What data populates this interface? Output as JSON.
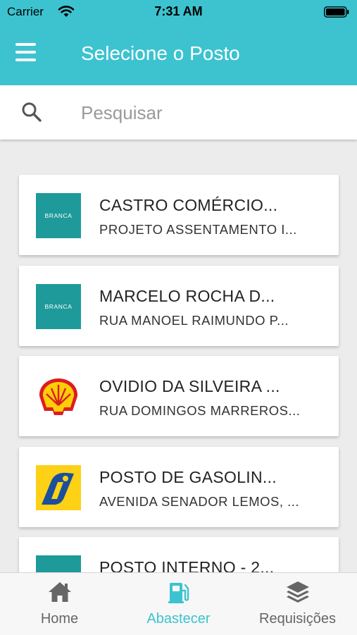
{
  "status_bar": {
    "carrier": "Carrier",
    "time": "7:31 AM"
  },
  "app_bar": {
    "title": "Selecione o Posto"
  },
  "search": {
    "placeholder": "Pesquisar",
    "value": ""
  },
  "stations": [
    {
      "name": "CASTRO COMÉRCIO...",
      "address": "PROJETO ASSENTAMENTO I...",
      "logo": "BRANCA",
      "logo_icon": "branca-logo"
    },
    {
      "name": "MARCELO ROCHA D...",
      "address": "RUA MANOEL RAIMUNDO P...",
      "logo": "BRANCA",
      "logo_icon": "branca-logo"
    },
    {
      "name": "OVIDIO DA SILVEIRA ...",
      "address": "RUA DOMINGOS MARREROS...",
      "logo": "",
      "logo_icon": "shell-logo"
    },
    {
      "name": "POSTO DE GASOLIN...",
      "address": "AVENIDA SENADOR LEMOS, ...",
      "logo": "",
      "logo_icon": "ipiranga-logo"
    },
    {
      "name": "POSTO INTERNO - 2...",
      "address": "",
      "logo": "",
      "logo_icon": "branca-logo"
    }
  ],
  "tabs": [
    {
      "label": "Home",
      "icon": "home-icon",
      "active": false
    },
    {
      "label": "Abastecer",
      "icon": "fuel-pump-icon",
      "active": true
    },
    {
      "label": "Requisições",
      "icon": "layers-icon",
      "active": false
    }
  ],
  "colors": {
    "primary": "#3cc3cf",
    "branca_logo": "#1e9a9a",
    "shell_red": "#dd1d21",
    "shell_yellow": "#fbce07",
    "ipiranga_yellow": "#fcd116",
    "ipiranga_blue": "#1b4f9c"
  }
}
